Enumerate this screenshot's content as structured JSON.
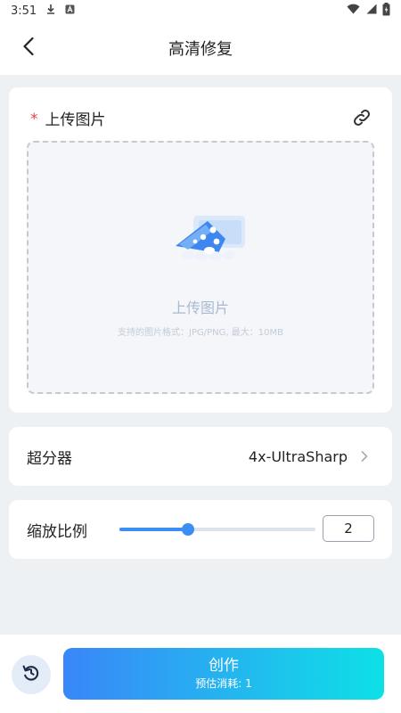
{
  "status_bar": {
    "time": "3:51"
  },
  "header": {
    "title": "高清修复",
    "back_icon": "chevron-left-icon"
  },
  "upload": {
    "required_mark": "*",
    "title": "上传图片",
    "link_icon": "link-icon",
    "dropzone_label": "上传图片",
    "hint": "支持的图片格式：JPG/PNG, 最大：10MB"
  },
  "upscaler": {
    "label": "超分器",
    "value": "4x-UltraSharp"
  },
  "scale": {
    "label": "缩放比例",
    "value": "2",
    "slider_fraction": 0.35
  },
  "footer": {
    "create_label": "创作",
    "cost_label": "预估消耗: 1"
  },
  "colors": {
    "accent": "#3d8ef2",
    "required": "#e5414a",
    "gradient_start": "#3a86f8",
    "gradient_end": "#0de0e6"
  }
}
